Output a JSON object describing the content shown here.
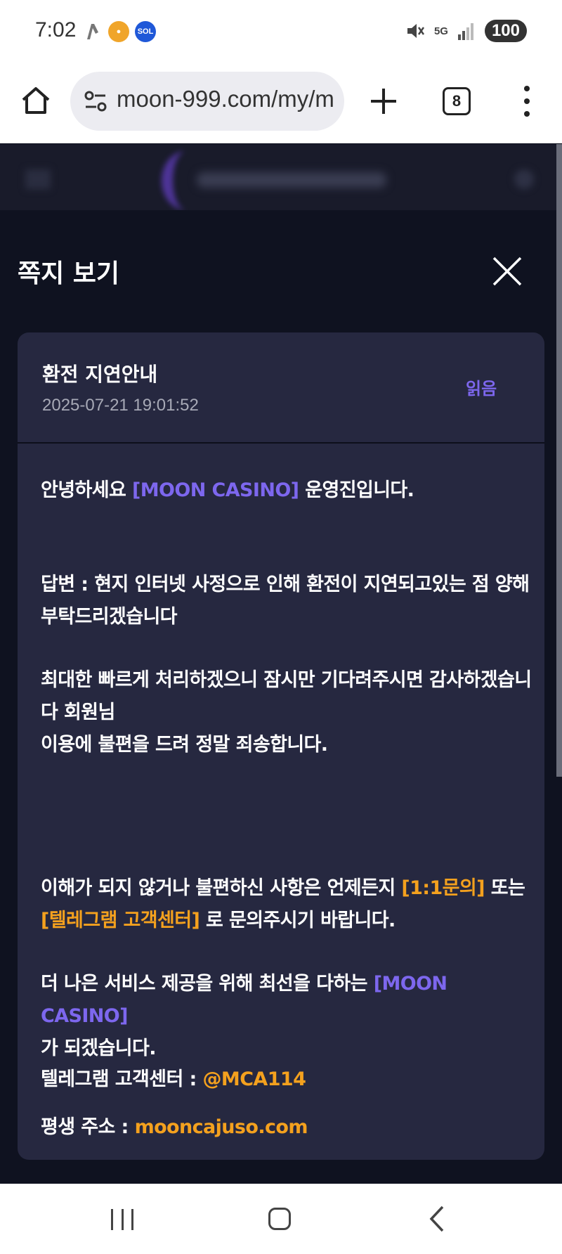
{
  "status_bar": {
    "time": "7:02",
    "battery": "100",
    "network": "5G"
  },
  "browser": {
    "url": "moon-999.com/my/m",
    "tab_count": "8"
  },
  "modal": {
    "title": "쪽지 보기"
  },
  "message": {
    "subject": "환전 지연안내",
    "date": "2025-07-21 19:01:52",
    "status": "읽음",
    "greeting_prefix": "안녕하세요",
    "brand": "[MOON CASINO]",
    "greeting_suffix": "운영진입니다.",
    "answer": "답변 : 현지 인터넷 사정으로 인해 환전이 지연되고있는 점 양해 부탁드리겠습니다",
    "wait_notice": "최대한 빠르게 처리하겠으니 잠시만 기다려주시면 감사하겠습니다 회원님",
    "apology": "이용에 불편을 드려 정말 죄송합니다.",
    "contact_prefix": "이해가 되지 않거나 불편하신 사항은 언제든지",
    "contact_link1": "[1:1문의]",
    "contact_mid": "또는",
    "contact_link2": "[텔레그램 고객센터]",
    "contact_suffix": "로 문의주시기 바랍니다.",
    "service_prefix": "더 나은 서비스 제공을 위해 최선을 다하는",
    "service_brand": "[MOON CASINO]",
    "service_suffix": "가 되겠습니다.",
    "telegram_label": "텔레그램 고객센터 :",
    "telegram_value": "@MCA114",
    "address_label": "평생 주소 :",
    "address_value": "mooncajuso.com"
  },
  "colors": {
    "accent_purple": "#7d67ee",
    "accent_orange": "#f4a11e",
    "card_bg": "#262840",
    "page_bg": "#0f1220"
  },
  "icons": {
    "home": "home-icon",
    "site_info": "site-settings-icon",
    "new_tab": "plus-icon",
    "tabs": "tab-switcher-icon",
    "menu": "more-vert-icon",
    "close": "close-icon",
    "mute": "mute-icon",
    "signal": "signal-icon"
  }
}
